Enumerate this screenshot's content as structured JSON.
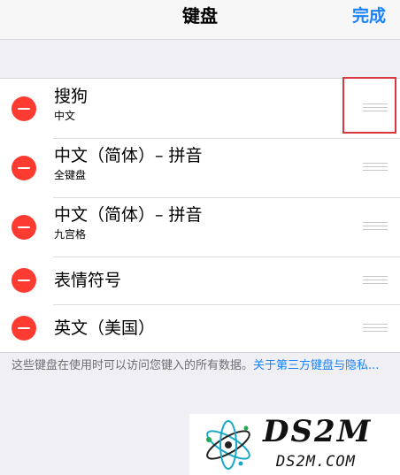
{
  "navbar": {
    "title": "键盘",
    "done_label": "完成"
  },
  "keyboards": [
    {
      "title": "搜狗",
      "subtitle": "中文"
    },
    {
      "title": "中文（简体）– 拼音",
      "subtitle": "全键盘"
    },
    {
      "title": "中文（简体）– 拼音",
      "subtitle": "九宫格"
    },
    {
      "title": "表情符号",
      "subtitle": ""
    },
    {
      "title": "英文（美国）",
      "subtitle": ""
    }
  ],
  "footer": {
    "text": "这些键盘在使用时可以访问您键入的所有数据。",
    "link": "关于第三方键盘与隐私..."
  },
  "watermark": {
    "title": "DS2M",
    "subtitle": "DS2M.COM"
  },
  "colors": {
    "accent": "#1a82fb",
    "delete": "#fd3b31",
    "highlight": "#d9363e",
    "background": "#efeff4"
  },
  "icons": {
    "delete": "minus-circle-icon",
    "reorder": "reorder-handle-icon"
  }
}
